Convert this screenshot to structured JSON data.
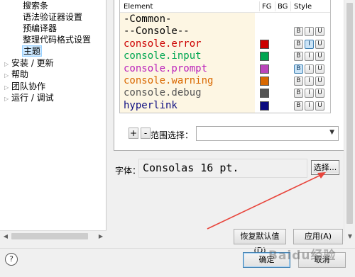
{
  "tree": {
    "items": [
      {
        "label": "搜索条",
        "indent": 2,
        "arrow": ""
      },
      {
        "label": "语法验证器设置",
        "indent": 2,
        "arrow": ""
      },
      {
        "label": "预编译器",
        "indent": 2,
        "arrow": ""
      },
      {
        "label": "整理代码格式设置",
        "indent": 2,
        "arrow": ""
      },
      {
        "label": "主题",
        "indent": 2,
        "arrow": "",
        "selected": true
      },
      {
        "label": "安装 / 更新",
        "indent": 0,
        "arrow": "▷"
      },
      {
        "label": "帮助",
        "indent": 0,
        "arrow": "▷"
      },
      {
        "label": "团队协作",
        "indent": 0,
        "arrow": "▷"
      },
      {
        "label": "运行 / 调试",
        "indent": 0,
        "arrow": "▷"
      }
    ]
  },
  "table": {
    "headers": {
      "element": "Element",
      "fg": "FG",
      "bg": "BG",
      "style": "Style"
    },
    "rows": [
      {
        "label": "-Common-",
        "color": "#000000",
        "swatch": ""
      },
      {
        "label": "--Console--",
        "color": "#000000",
        "swatch": ""
      },
      {
        "label": "console.error",
        "color": "#cc0000",
        "swatch": "#cc0000"
      },
      {
        "label": "console.input",
        "color": "#00a651",
        "swatch": "#00a651"
      },
      {
        "label": "console.prompt",
        "color": "#bb22bb",
        "swatch": "#bb44bb"
      },
      {
        "label": "console.warning",
        "color": "#d96800",
        "swatch": "#d96800"
      },
      {
        "label": "console.debug",
        "color": "#555555",
        "swatch": "#555555"
      },
      {
        "label": "hyperlink",
        "color": "#0b0b80",
        "swatch": "#0b0b80"
      },
      {
        "label": "...",
        "color": "#000000",
        "swatch": ""
      }
    ],
    "style_buttons": [
      "B",
      "I",
      "U"
    ],
    "active_style": {
      "row_2": "I",
      "row_4": "B"
    }
  },
  "controls": {
    "add": "+",
    "remove": "-",
    "scope_label": "范围选择：",
    "scope_value": ""
  },
  "font": {
    "label": "字体：",
    "value": "Consolas 16 pt.",
    "select_button": "选择..."
  },
  "page_buttons": {
    "restore": "恢复默认值(D)",
    "apply": "应用(A)"
  },
  "dialog": {
    "help": "?",
    "ok": "确定",
    "cancel": "取消"
  },
  "watermark": "Baidu经验",
  "colors": {
    "annotation_arrow": "#e8453c",
    "selection": "#cce8ff",
    "element_bg": "#fdf6e3"
  }
}
